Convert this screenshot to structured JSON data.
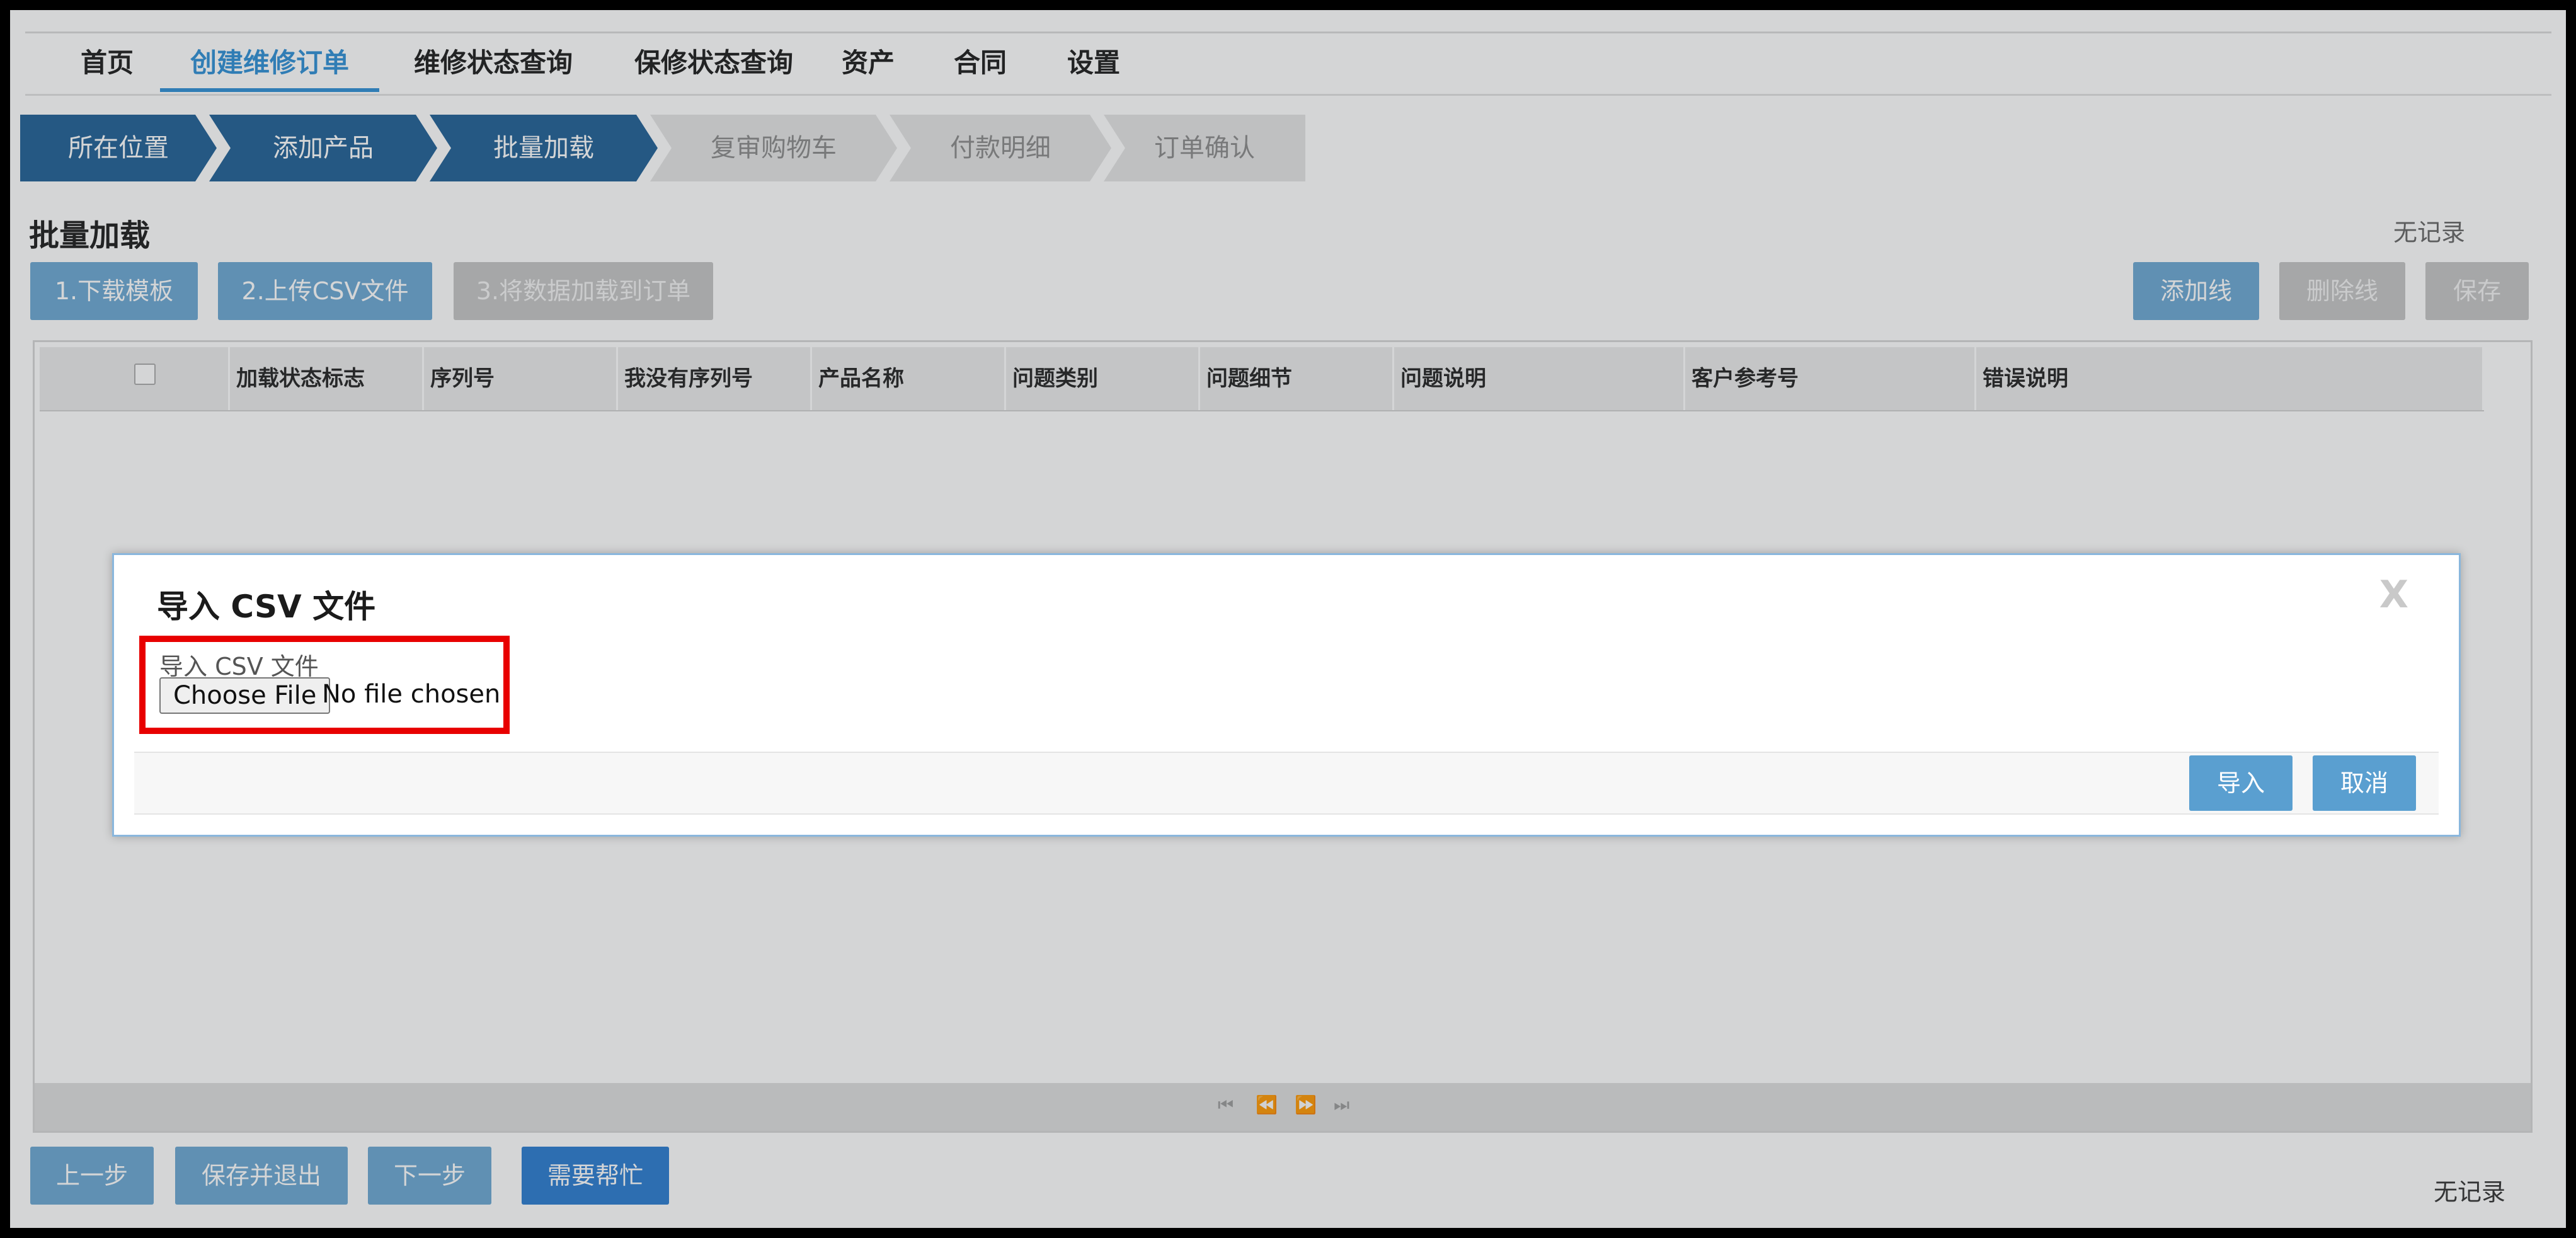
{
  "nav": {
    "tabs": [
      {
        "label": "首页"
      },
      {
        "label": "创建维修订单"
      },
      {
        "label": "维修状态查询"
      },
      {
        "label": "保修状态查询"
      },
      {
        "label": "资产"
      },
      {
        "label": "合同"
      },
      {
        "label": "设置"
      }
    ],
    "active_index": 1
  },
  "steps": [
    {
      "label": "所在位置",
      "state": "done"
    },
    {
      "label": "添加产品",
      "state": "done"
    },
    {
      "label": "批量加载",
      "state": "done"
    },
    {
      "label": "复审购物车",
      "state": "todo"
    },
    {
      "label": "付款明细",
      "state": "todo"
    },
    {
      "label": "订单确认",
      "state": "todo"
    }
  ],
  "page": {
    "title": "批量加载",
    "no_record_top": "无记录",
    "no_record_bottom": "无记录"
  },
  "toolbar": {
    "download_template": "1.下载模板",
    "upload_csv": "2.上传CSV文件",
    "load_to_order": "3.将数据加载到订单",
    "add_line": "添加线",
    "delete_line": "删除线",
    "save": "保存"
  },
  "grid": {
    "columns": [
      "加载状态标志",
      "序列号",
      "我没有序列号",
      "产品名称",
      "问题类别",
      "问题细节",
      "问题说明",
      "客户参考号",
      "错误说明"
    ],
    "pager": {
      "first": "⏮",
      "prev": "⏪",
      "next": "⏩",
      "last": "⏭"
    }
  },
  "dialog": {
    "title": "导入 CSV 文件",
    "close": "X",
    "field_label": "导入 CSV 文件",
    "choose_file": "Choose File",
    "no_file": "No file chosen",
    "import_button": "导入",
    "cancel_button": "取消"
  },
  "footer": {
    "prev_step": "上一步",
    "save_exit": "保存并退出",
    "next_step": "下一步",
    "need_help": "需要帮忙"
  },
  "colors": {
    "accent": "#2d8fd5",
    "step_done": "#1f5f95",
    "button_blue": "#6ba7d3",
    "highlight_border": "#e80000"
  }
}
